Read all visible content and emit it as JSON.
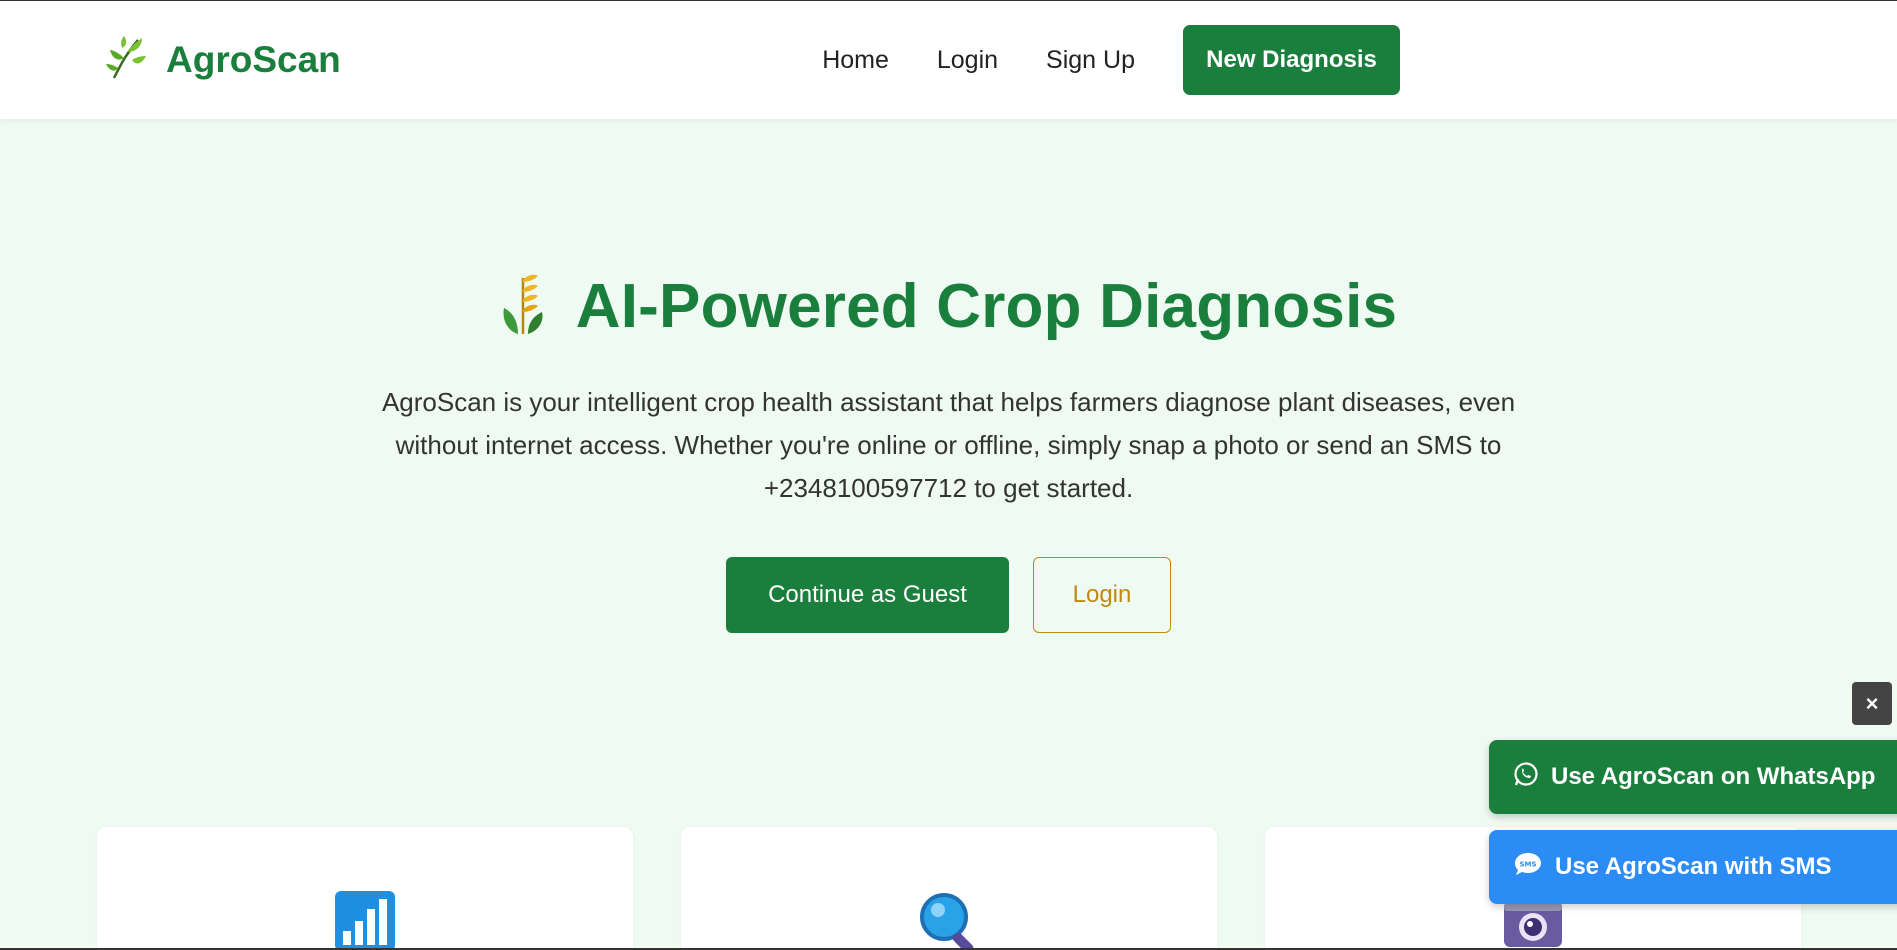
{
  "header": {
    "brand": "AgroScan",
    "nav": [
      "Home",
      "Login",
      "Sign Up"
    ],
    "cta": "New Diagnosis"
  },
  "hero": {
    "title": "AI-Powered Crop Diagnosis",
    "description": "AgroScan is your intelligent crop health assistant that helps farmers diagnose plant diseases, even without internet access. Whether you're online or offline, simply snap a photo or send an SMS to +2348100597712 to get started.",
    "guest_button": "Continue as Guest",
    "login_button": "Login"
  },
  "cards": [
    {
      "icon": "bar-chart-icon"
    },
    {
      "icon": "magnifier-icon"
    },
    {
      "icon": "camera-icon"
    }
  ],
  "floating": {
    "close": "×",
    "whatsapp": "Use AgroScan on WhatsApp",
    "sms": "Use AgroScan with SMS"
  },
  "colors": {
    "brand_green": "#1a7f3d",
    "accent_gold": "#c08a10",
    "sms_blue": "#2b8cf5",
    "background": "#eefaf2"
  }
}
